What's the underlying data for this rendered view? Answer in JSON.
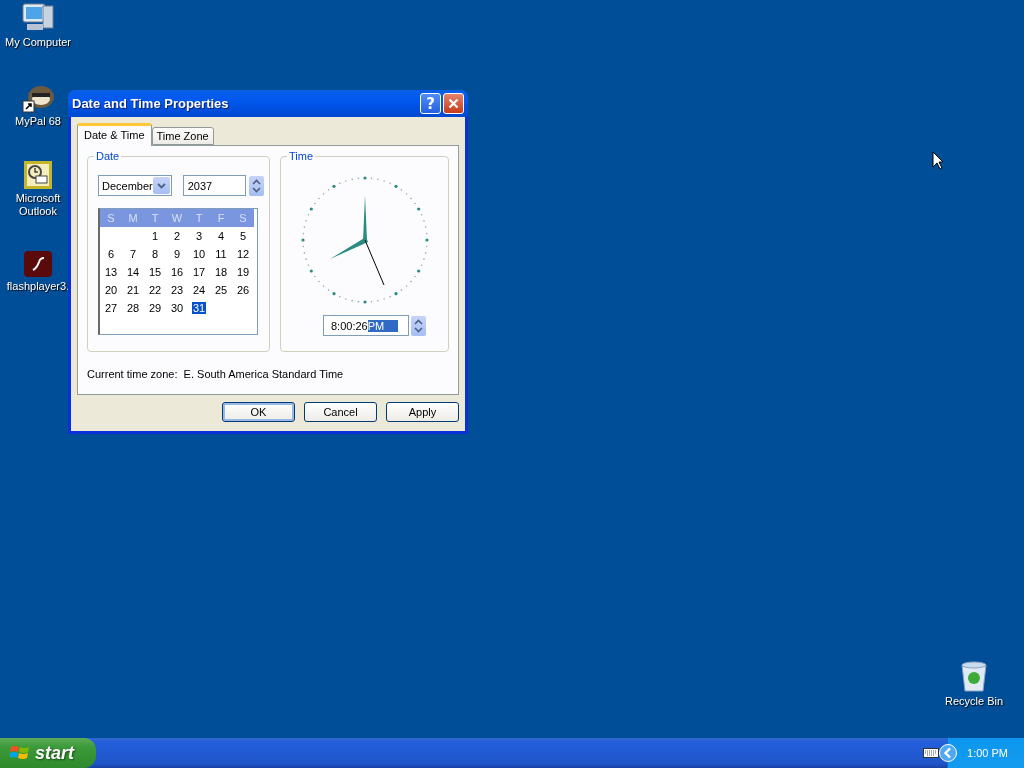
{
  "desktop_icons": [
    {
      "label": "My Computer",
      "kind": "computer"
    },
    {
      "label": "MyPal 68",
      "kind": "raccoon"
    },
    {
      "label": "Microsoft Outlook",
      "kind": "outlook"
    },
    {
      "label": "flashplayer3.",
      "kind": "flash"
    }
  ],
  "recycle_bin": {
    "label": "Recycle Bin"
  },
  "dialog": {
    "title": "Date and Time Properties",
    "help_label": "?",
    "tabs": [
      {
        "label": "Date & Time",
        "selected": true
      },
      {
        "label": "Time Zone",
        "selected": false
      }
    ],
    "date_group": {
      "title": "Date",
      "month": "December",
      "year": "2037",
      "weekdays": [
        "S",
        "M",
        "T",
        "W",
        "T",
        "F",
        "S"
      ],
      "weeks": [
        [
          {
            "day": "1",
            "selected": false
          },
          {
            "day": "2",
            "selected": false
          },
          {
            "day": "3",
            "selected": false
          },
          {
            "day": "4",
            "selected": false
          },
          {
            "day": "5",
            "selected": false
          }
        ],
        [
          {
            "day": "6",
            "selected": false
          },
          {
            "day": "7",
            "selected": false
          },
          {
            "day": "8",
            "selected": false
          },
          {
            "day": "9",
            "selected": false
          },
          {
            "day": "10",
            "selected": false
          },
          {
            "day": "11",
            "selected": false
          },
          {
            "day": "12",
            "selected": false
          }
        ],
        [
          {
            "day": "13",
            "selected": false
          },
          {
            "day": "14",
            "selected": false
          },
          {
            "day": "15",
            "selected": false
          },
          {
            "day": "16",
            "selected": false
          },
          {
            "day": "17",
            "selected": false
          },
          {
            "day": "18",
            "selected": false
          },
          {
            "day": "19",
            "selected": false
          }
        ],
        [
          {
            "day": "20",
            "selected": false
          },
          {
            "day": "21",
            "selected": false
          },
          {
            "day": "22",
            "selected": false
          },
          {
            "day": "23",
            "selected": false
          },
          {
            "day": "24",
            "selected": false
          },
          {
            "day": "25",
            "selected": false
          },
          {
            "day": "26",
            "selected": false
          }
        ],
        [
          {
            "day": "27",
            "selected": false
          },
          {
            "day": "28",
            "selected": false
          },
          {
            "day": "29",
            "selected": false
          },
          {
            "day": "30",
            "selected": false
          },
          {
            "day": "31",
            "selected": true
          }
        ]
      ]
    },
    "time_group": {
      "title": "Time",
      "time": "8:00:26",
      "ampm": "PM",
      "ampm_selected": true
    },
    "current_time_zone": "Current time zone:  E. South America Standard Time",
    "buttons": [
      {
        "label": "OK",
        "default": true
      },
      {
        "label": "Cancel",
        "default": false
      },
      {
        "label": "Apply",
        "default": false
      }
    ]
  },
  "taskbar": {
    "start": "start",
    "clock": "1:00 PM"
  }
}
